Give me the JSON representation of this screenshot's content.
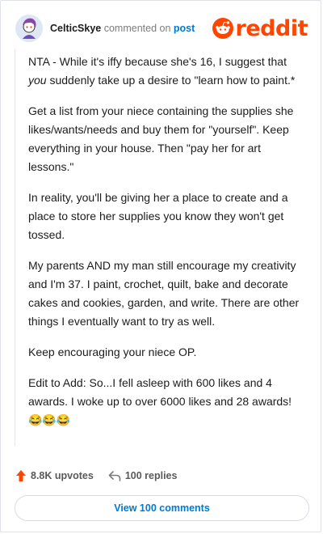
{
  "header": {
    "username": "CelticSkye",
    "action_text": "commented on",
    "post_link": "post",
    "brand": "reddit"
  },
  "comment": {
    "paragraphs": [
      "NTA - While it's iffy because she's 16, I suggest that ",
      "Get a list from your niece containing the supplies she likes/wants/needs and buy them for \"yourself\". Keep everything in your house. Then \"pay her for art lessons.\"",
      "In reality, you'll be giving her a place to create and a place to store her supplies you know they won't get tossed.",
      "My parents AND my man still encourage my creativity and I'm 37. I paint, crochet, quilt, bake and decorate cakes and cookies, garden, and write. There are other things I eventually want to try as well.",
      "Keep encouraging your niece OP.",
      "Edit to Add: So...I fell asleep with 600 likes and 4 awards. I woke up to over 6000 likes and 28 awards! 😂😂😂"
    ],
    "p1_emphasis": "you",
    "p1_rest": " suddenly take up a desire to \"learn how to paint.*"
  },
  "footer": {
    "upvotes": "8.8K upvotes",
    "replies": "100 replies",
    "view_comments": "View 100 comments"
  },
  "colors": {
    "accent": "#ff4500",
    "link": "#0079d3"
  },
  "icons": {
    "avatar": "snoo-avatar",
    "brand": "reddit-snoo-icon",
    "upvote": "upvote-arrow-icon",
    "reply": "reply-arrow-icon"
  }
}
